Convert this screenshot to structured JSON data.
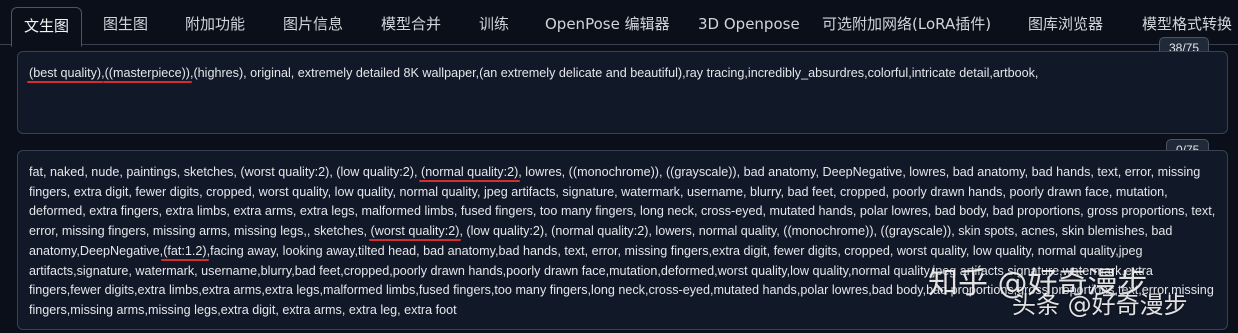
{
  "tabs": [
    {
      "label": "文生图",
      "active": true
    },
    {
      "label": "图生图"
    },
    {
      "label": "附加功能"
    },
    {
      "label": "图片信息"
    },
    {
      "label": "模型合并"
    },
    {
      "label": "训练"
    },
    {
      "label": "OpenPose 编辑器"
    },
    {
      "label": "3D Openpose"
    },
    {
      "label": "可选附加网络(LoRA插件)"
    },
    {
      "label": "图库浏览器"
    },
    {
      "label": "模型格式转换"
    }
  ],
  "positive_prompt": {
    "counter": "38/75",
    "segments": [
      {
        "text": "(best quality)",
        "underline": true
      },
      {
        "text": ",",
        "underline": false
      },
      {
        "text": "((masterpiece))",
        "underline": true
      },
      {
        "text": ",(highres), original, extremely detailed 8K wallpaper,(an extremely delicate and beautiful),ray tracing,incredibly_absurdres,colorful,intricate detail,artbook,",
        "underline": false
      }
    ]
  },
  "negative_prompt": {
    "counter": "0/75",
    "segments": [
      {
        "text": "fat, naked, nude, paintings, sketches, (worst quality:2), (low quality:2), ",
        "underline": false
      },
      {
        "text": "(normal quality:2)",
        "underline": true
      },
      {
        "text": ", lowres, ((monochrome)), ((grayscale)), bad anatomy, DeepNegative, lowres, bad anatomy, bad hands, text, error, missing fingers, extra digit, fewer digits, cropped, worst quality, low quality, normal quality, jpeg artifacts, signature, watermark, username, blurry, bad feet, cropped, poorly drawn hands, poorly drawn face, mutation, deformed, extra fingers, extra limbs, extra arms, extra legs, malformed limbs, fused fingers, too many fingers, long neck, cross-eyed, mutated hands, polar lowres, bad body, bad proportions, gross proportions, text, error, missing fingers, missing arms, missing legs,, sketches, ",
        "underline": false
      },
      {
        "text": "(worst quality:2)",
        "underline": true
      },
      {
        "text": ", (low quality:2), (normal quality:2), lowers, normal quality, ((monochrome)), ((grayscale)), skin spots, acnes, skin blemishes, bad anatomy,DeepNegative,",
        "underline": false
      },
      {
        "text": "(fat:1.2)",
        "underline": true
      },
      {
        "text": ",facing away, looking away,tilted head, bad anatomy,bad hands, text, error, missing fingers,extra digit, fewer digits, cropped, worst quality, low quality, normal quality,jpeg artifacts,signature, watermark, username,blurry,bad feet,cropped,poorly drawn hands,poorly drawn face,mutation,deformed,worst quality,low quality,normal quality,jpeg artifacts,signature,watermark,extra fingers,fewer digits,extra limbs,extra arms,extra legs,malformed limbs,fused fingers,too many fingers,long neck,cross-eyed,mutated hands,polar lowres,bad body,bad proportions,gross proportions,text,error,missing fingers,missing arms,missing legs,extra digit, extra arms, extra leg, extra foot",
        "underline": false
      }
    ]
  },
  "watermark": {
    "line1": "知乎 @好奇漫步",
    "line2": "头条 @好奇漫步"
  },
  "colors": {
    "background": "#0b0f19",
    "box": "#111827",
    "underline": "#d42e2e"
  }
}
